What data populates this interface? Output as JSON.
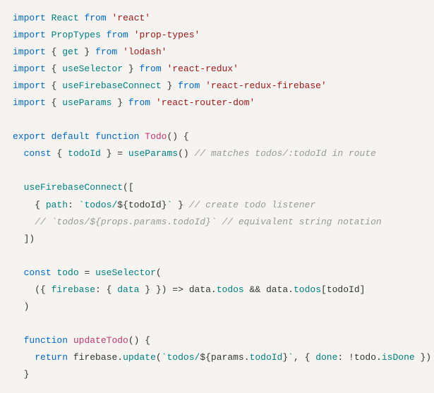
{
  "lines": [
    {
      "tokens": [
        {
          "c": "kw",
          "t": "import"
        },
        {
          "c": "punc",
          "t": " "
        },
        {
          "c": "def",
          "t": "React"
        },
        {
          "c": "punc",
          "t": " "
        },
        {
          "c": "kw",
          "t": "from"
        },
        {
          "c": "punc",
          "t": " "
        },
        {
          "c": "str",
          "t": "'react'"
        }
      ]
    },
    {
      "tokens": [
        {
          "c": "kw",
          "t": "import"
        },
        {
          "c": "punc",
          "t": " "
        },
        {
          "c": "def",
          "t": "PropTypes"
        },
        {
          "c": "punc",
          "t": " "
        },
        {
          "c": "kw",
          "t": "from"
        },
        {
          "c": "punc",
          "t": " "
        },
        {
          "c": "str",
          "t": "'prop-types'"
        }
      ]
    },
    {
      "tokens": [
        {
          "c": "kw",
          "t": "import"
        },
        {
          "c": "punc",
          "t": " { "
        },
        {
          "c": "def",
          "t": "get"
        },
        {
          "c": "punc",
          "t": " } "
        },
        {
          "c": "kw",
          "t": "from"
        },
        {
          "c": "punc",
          "t": " "
        },
        {
          "c": "str",
          "t": "'lodash'"
        }
      ]
    },
    {
      "tokens": [
        {
          "c": "kw",
          "t": "import"
        },
        {
          "c": "punc",
          "t": " { "
        },
        {
          "c": "def",
          "t": "useSelector"
        },
        {
          "c": "punc",
          "t": " } "
        },
        {
          "c": "kw",
          "t": "from"
        },
        {
          "c": "punc",
          "t": " "
        },
        {
          "c": "str",
          "t": "'react-redux'"
        }
      ]
    },
    {
      "tokens": [
        {
          "c": "kw",
          "t": "import"
        },
        {
          "c": "punc",
          "t": " { "
        },
        {
          "c": "def",
          "t": "useFirebaseConnect"
        },
        {
          "c": "punc",
          "t": " } "
        },
        {
          "c": "kw",
          "t": "from"
        },
        {
          "c": "punc",
          "t": " "
        },
        {
          "c": "str",
          "t": "'react-redux-firebase'"
        }
      ]
    },
    {
      "tokens": [
        {
          "c": "kw",
          "t": "import"
        },
        {
          "c": "punc",
          "t": " { "
        },
        {
          "c": "def",
          "t": "useParams"
        },
        {
          "c": "punc",
          "t": " } "
        },
        {
          "c": "kw",
          "t": "from"
        },
        {
          "c": "punc",
          "t": " "
        },
        {
          "c": "str",
          "t": "'react-router-dom'"
        }
      ]
    },
    {
      "tokens": [
        {
          "c": "punc",
          "t": ""
        }
      ]
    },
    {
      "tokens": [
        {
          "c": "kw",
          "t": "export"
        },
        {
          "c": "punc",
          "t": " "
        },
        {
          "c": "kw",
          "t": "default"
        },
        {
          "c": "punc",
          "t": " "
        },
        {
          "c": "kw",
          "t": "function"
        },
        {
          "c": "punc",
          "t": " "
        },
        {
          "c": "fn-name",
          "t": "Todo"
        },
        {
          "c": "punc",
          "t": "() {"
        }
      ]
    },
    {
      "tokens": [
        {
          "c": "punc",
          "t": "  "
        },
        {
          "c": "kw",
          "t": "const"
        },
        {
          "c": "punc",
          "t": " { "
        },
        {
          "c": "def",
          "t": "todoId"
        },
        {
          "c": "punc",
          "t": " } = "
        },
        {
          "c": "fn-call",
          "t": "useParams"
        },
        {
          "c": "punc",
          "t": "() "
        },
        {
          "c": "comment",
          "t": "// matches todos/:todoId in route"
        }
      ]
    },
    {
      "tokens": [
        {
          "c": "punc",
          "t": ""
        }
      ]
    },
    {
      "tokens": [
        {
          "c": "punc",
          "t": "  "
        },
        {
          "c": "fn-call",
          "t": "useFirebaseConnect"
        },
        {
          "c": "punc",
          "t": "(["
        }
      ]
    },
    {
      "tokens": [
        {
          "c": "punc",
          "t": "    { "
        },
        {
          "c": "prop",
          "t": "path"
        },
        {
          "c": "punc",
          "t": ": "
        },
        {
          "c": "tmpl",
          "t": "`todos/"
        },
        {
          "c": "punc",
          "t": "${"
        },
        {
          "c": "var",
          "t": "todoId"
        },
        {
          "c": "punc",
          "t": "}"
        },
        {
          "c": "tmpl",
          "t": "`"
        },
        {
          "c": "punc",
          "t": " } "
        },
        {
          "c": "comment",
          "t": "// create todo listener"
        }
      ]
    },
    {
      "tokens": [
        {
          "c": "punc",
          "t": "    "
        },
        {
          "c": "comment",
          "t": "// `todos/${props.params.todoId}` // equivalent string notation"
        }
      ]
    },
    {
      "tokens": [
        {
          "c": "punc",
          "t": "  ])"
        }
      ]
    },
    {
      "tokens": [
        {
          "c": "punc",
          "t": ""
        }
      ]
    },
    {
      "tokens": [
        {
          "c": "punc",
          "t": "  "
        },
        {
          "c": "kw",
          "t": "const"
        },
        {
          "c": "punc",
          "t": " "
        },
        {
          "c": "def",
          "t": "todo"
        },
        {
          "c": "punc",
          "t": " = "
        },
        {
          "c": "fn-call",
          "t": "useSelector"
        },
        {
          "c": "punc",
          "t": "("
        }
      ]
    },
    {
      "tokens": [
        {
          "c": "punc",
          "t": "    ({ "
        },
        {
          "c": "prop",
          "t": "firebase"
        },
        {
          "c": "punc",
          "t": ": { "
        },
        {
          "c": "def",
          "t": "data"
        },
        {
          "c": "punc",
          "t": " } }) => "
        },
        {
          "c": "var",
          "t": "data"
        },
        {
          "c": "punc",
          "t": "."
        },
        {
          "c": "prop",
          "t": "todos"
        },
        {
          "c": "punc",
          "t": " && "
        },
        {
          "c": "var",
          "t": "data"
        },
        {
          "c": "punc",
          "t": "."
        },
        {
          "c": "prop",
          "t": "todos"
        },
        {
          "c": "punc",
          "t": "["
        },
        {
          "c": "var",
          "t": "todoId"
        },
        {
          "c": "punc",
          "t": "]"
        }
      ]
    },
    {
      "tokens": [
        {
          "c": "punc",
          "t": "  )"
        }
      ]
    },
    {
      "tokens": [
        {
          "c": "punc",
          "t": ""
        }
      ]
    },
    {
      "tokens": [
        {
          "c": "punc",
          "t": "  "
        },
        {
          "c": "kw",
          "t": "function"
        },
        {
          "c": "punc",
          "t": " "
        },
        {
          "c": "fn-name",
          "t": "updateTodo"
        },
        {
          "c": "punc",
          "t": "() {"
        }
      ]
    },
    {
      "tokens": [
        {
          "c": "punc",
          "t": "    "
        },
        {
          "c": "kw",
          "t": "return"
        },
        {
          "c": "punc",
          "t": " "
        },
        {
          "c": "var",
          "t": "firebase"
        },
        {
          "c": "punc",
          "t": "."
        },
        {
          "c": "fn-call",
          "t": "update"
        },
        {
          "c": "punc",
          "t": "("
        },
        {
          "c": "tmpl",
          "t": "`todos/"
        },
        {
          "c": "punc",
          "t": "${"
        },
        {
          "c": "var",
          "t": "params"
        },
        {
          "c": "punc",
          "t": "."
        },
        {
          "c": "prop",
          "t": "todoId"
        },
        {
          "c": "punc",
          "t": "}"
        },
        {
          "c": "tmpl",
          "t": "`"
        },
        {
          "c": "punc",
          "t": ", { "
        },
        {
          "c": "prop",
          "t": "done"
        },
        {
          "c": "punc",
          "t": ": !"
        },
        {
          "c": "var",
          "t": "todo"
        },
        {
          "c": "punc",
          "t": "."
        },
        {
          "c": "prop",
          "t": "isDone"
        },
        {
          "c": "punc",
          "t": " })"
        }
      ]
    },
    {
      "tokens": [
        {
          "c": "punc",
          "t": "  }"
        }
      ]
    }
  ]
}
